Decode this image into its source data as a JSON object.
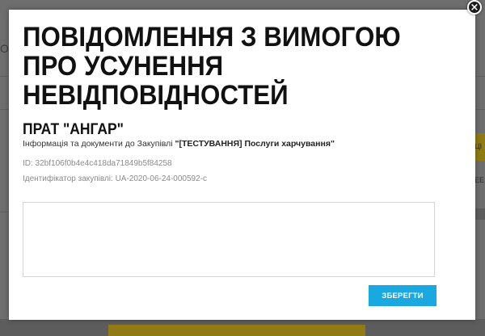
{
  "background": {
    "left_fragment": "О",
    "right_fragment_1": "ЦІ",
    "right_fragment_2": "ЕЕ"
  },
  "modal": {
    "close_glyph": "×",
    "title": "ПОВІДОМЛЕННЯ З ВИМОГОЮ ПРО УСУНЕННЯ НЕВІДПОВІДНОСТЕЙ",
    "organization": "ПРАТ \"АНГАР\"",
    "info_prefix": "Інформація та документи до Закупівлі ",
    "tender_name": "\"[ТЕСТУВАННЯ] Послуги харчування\"",
    "id_line": "ID: 32bf106f0b4e4c418da71849b5f84258",
    "tender_id_line": "Ідентифікатор закупівлі: UA-2020-06-24-000592-c",
    "message_value": "",
    "message_placeholder": "",
    "save_label": "ЗБЕРЕГТИ"
  },
  "colors": {
    "accent": "#1aa8e0",
    "overlay": "#6e6e6e",
    "highlight_dim": "#8f7a14"
  }
}
